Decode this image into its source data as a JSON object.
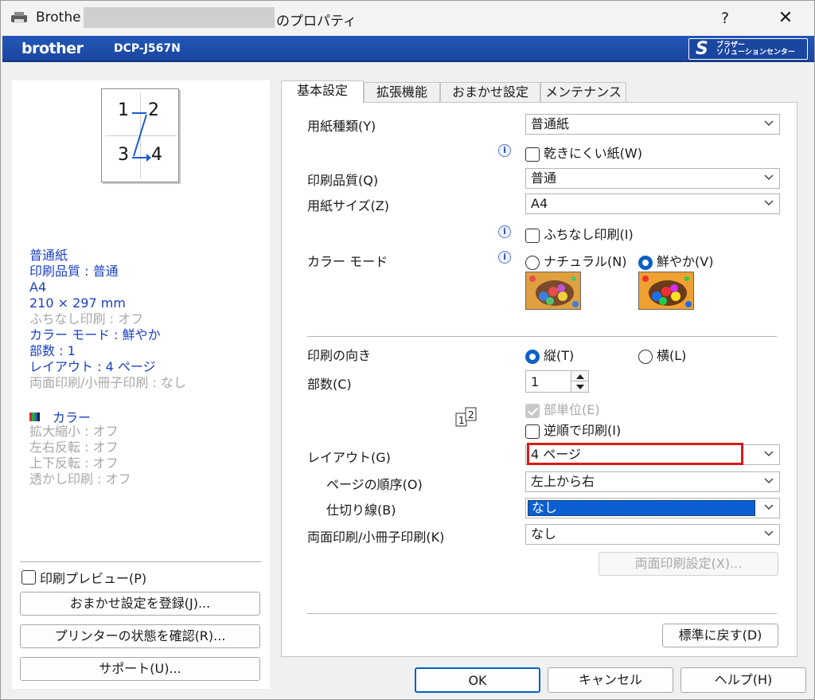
{
  "window": {
    "title_prefix": "Brothe",
    "title_suffix": "のプロパティ",
    "help_label": "?",
    "close_label": "✕"
  },
  "brand": {
    "logo": "brother",
    "model": "DCP-J567N",
    "solution_line1": "ブラザー",
    "solution_line2": "ソリューションセンター"
  },
  "preview": {
    "thumb_numbers": [
      "1",
      "2",
      "3",
      "4"
    ]
  },
  "summary": {
    "active": [
      "普通紙",
      "印刷品質 : 普通",
      "A4",
      "210 × 297 mm"
    ],
    "disabled_1": "ふちなし印刷 : オフ",
    "active_2": [
      "カラー モード : 鮮やか",
      "部数 : 1",
      "レイアウト : 4 ページ"
    ],
    "disabled_2": "両面印刷/小冊子印刷 : なし",
    "color_label": "カラー",
    "disabled_3": [
      "拡大縮小 : オフ",
      "左右反転 : オフ",
      "上下反転 : オフ",
      "透かし印刷 : オフ"
    ]
  },
  "left_buttons": {
    "preview_checkbox": "印刷プレビュー(P)",
    "register": "おまかせ設定を登録(J)...",
    "status": "プリンターの状態を確認(R)...",
    "support": "サポート(U)..."
  },
  "tabs": [
    "基本設定",
    "拡張機能",
    "おまかせ設定",
    "メンテナンス"
  ],
  "form": {
    "paper_type_label": "用紙種類(Y)",
    "paper_type_value": "普通紙",
    "slow_dry_label": "乾きにくい紙(W)",
    "quality_label": "印刷品質(Q)",
    "quality_value": "普通",
    "paper_size_label": "用紙サイズ(Z)",
    "paper_size_value": "A4",
    "borderless_label": "ふちなし印刷(I)",
    "color_mode_label": "カラー モード",
    "natural_label": "ナチュラル(N)",
    "vivid_label": "鮮やか(V)",
    "orientation_label": "印刷の向き",
    "portrait_label": "縦(T)",
    "landscape_label": "横(L)",
    "copies_label": "部数(C)",
    "copies_value": "1",
    "collate_label": "部単位(E)",
    "reverse_label": "逆順で印刷(I)",
    "layout_label": "レイアウト(G)",
    "layout_value": "4 ページ",
    "page_order_label": "ページの順序(O)",
    "page_order_value": "左上から右",
    "border_line_label": "仕切り線(B)",
    "border_line_value": "なし",
    "duplex_label": "両面印刷/小冊子印刷(K)",
    "duplex_value": "なし",
    "duplex_settings_label": "両面印刷設定(X)...",
    "default_label": "標準に戻す(D)"
  },
  "footer": {
    "ok": "OK",
    "cancel": "キャンセル",
    "help": "ヘルプ(H)"
  },
  "colors": {
    "brand_blue": "#1b46a0",
    "accent_blue": "#0a5fc7",
    "summary_blue": "#1a3fc4",
    "highlight_red": "#d91a1a"
  }
}
